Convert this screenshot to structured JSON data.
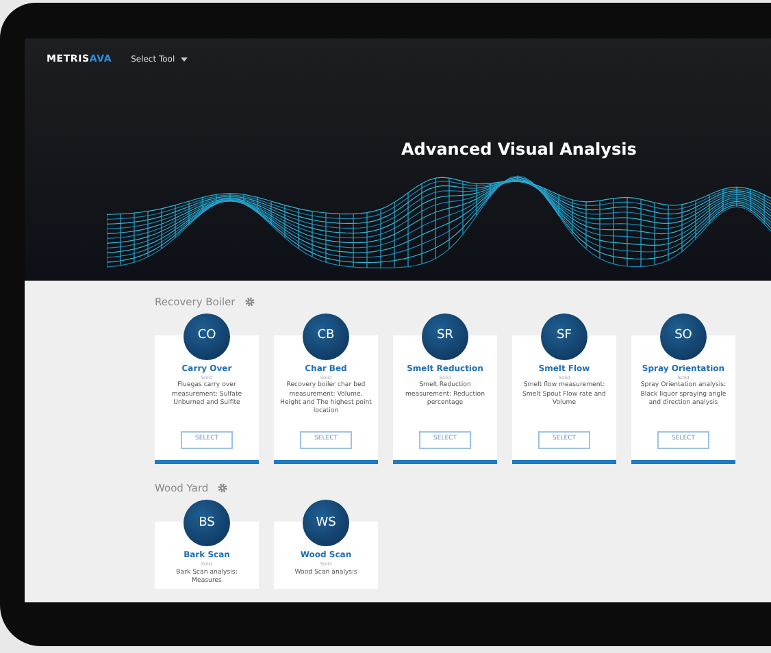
{
  "header": {
    "logo_main": "METRIS",
    "logo_accent": "AVA",
    "menu": "Select Tool"
  },
  "hero": {
    "title": "Advanced Visual Analysis"
  },
  "sections": [
    {
      "title": "Recovery Boiler",
      "tools": [
        {
          "abbr": "CO",
          "name": "Carry Over",
          "subtitle": "Solid",
          "description": "Fluegas carry over measurement: Sulfate Unburned and Sulfite",
          "button": "SELECT"
        },
        {
          "abbr": "CB",
          "name": "Char Bed",
          "subtitle": "Solid",
          "description": "Recovery boiler char bed measurement: Volume, Height and The highest point location",
          "button": "SELECT"
        },
        {
          "abbr": "SR",
          "name": "Smelt Reduction",
          "subtitle": "Solid",
          "description": "Smelt Reduction measurement: Reduction percentage",
          "button": "SELECT"
        },
        {
          "abbr": "SF",
          "name": "Smelt Flow",
          "subtitle": "Solid",
          "description": "Smelt flow measurement: Smelt Spout Flow rate and Volume",
          "button": "SELECT"
        },
        {
          "abbr": "SO",
          "name": "Spray Orientation",
          "subtitle": "Solid",
          "description": "Spray Orientation analysis: Black liquor spraying angle and direction analysis",
          "button": "SELECT"
        }
      ]
    },
    {
      "title": "Wood Yard",
      "tools": [
        {
          "abbr": "BS",
          "name": "Bark Scan",
          "subtitle": "Solid",
          "description": "Bark Scan analysis: Measures"
        },
        {
          "abbr": "WS",
          "name": "Wood Scan",
          "subtitle": "Solid",
          "description": "Wood Scan analysis"
        }
      ]
    }
  ]
}
